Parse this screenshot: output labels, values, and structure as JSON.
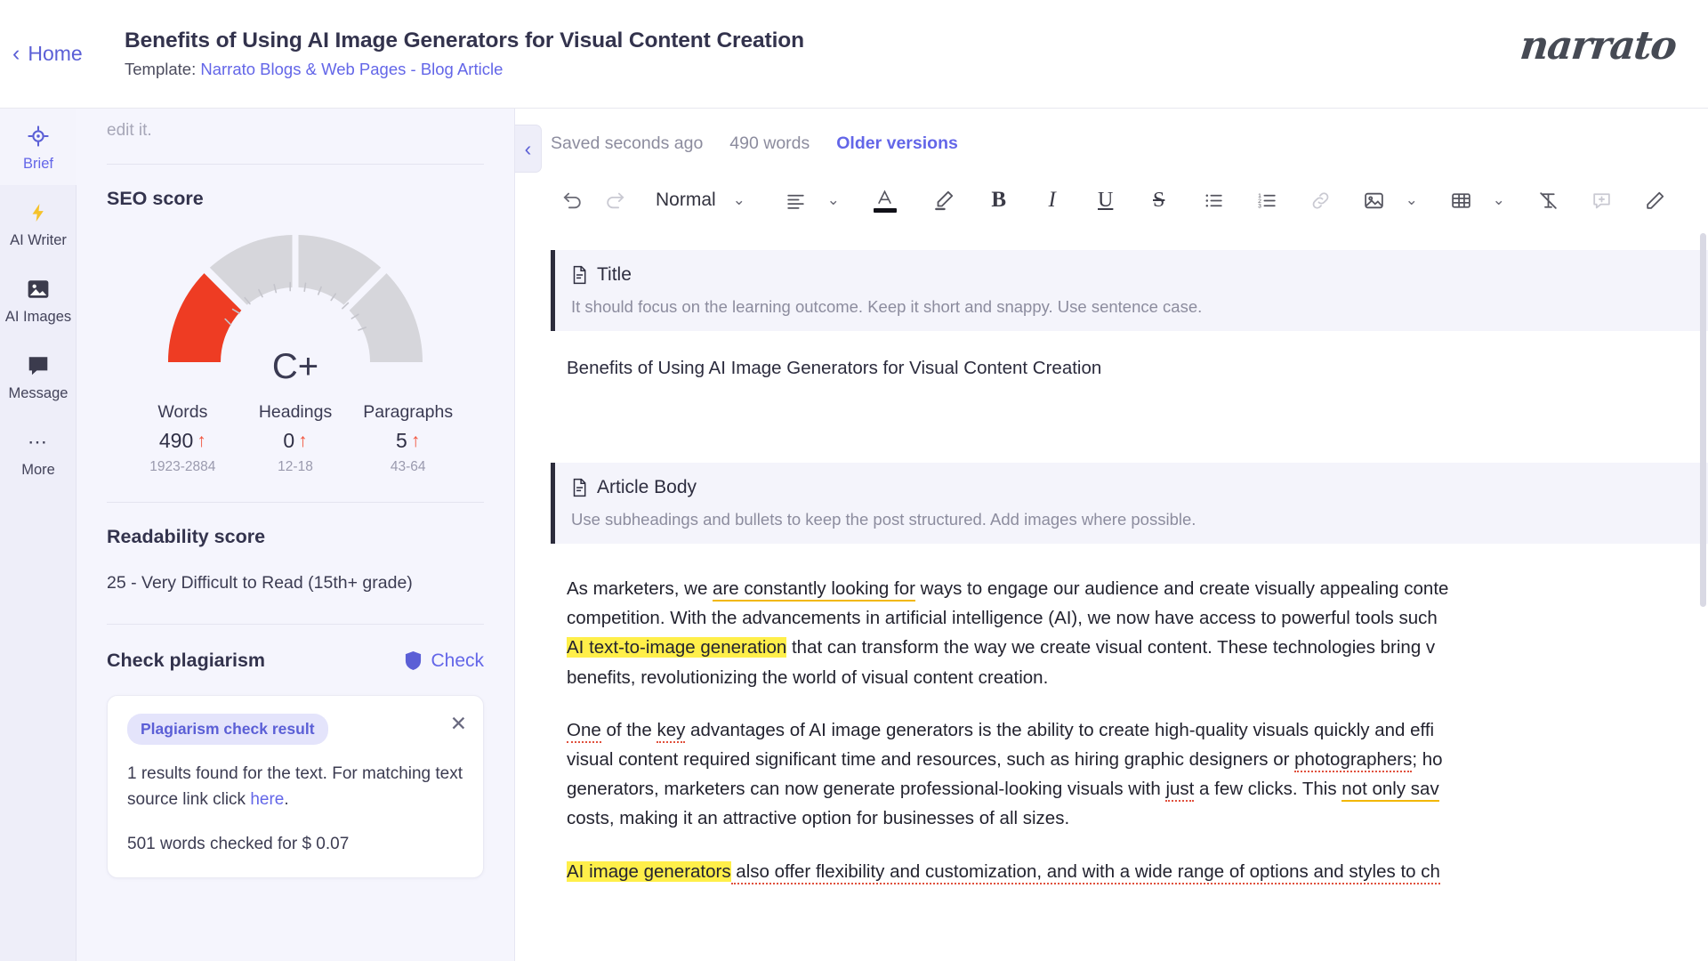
{
  "topbar": {
    "home_label": "Home",
    "doc_title": "Benefits of Using AI Image Generators for Visual Content Creation",
    "template_prefix": "Template: ",
    "template_name": "Narrato Blogs & Web Pages - Blog Article",
    "brand": "narrato"
  },
  "rail": {
    "items": [
      {
        "label": "Brief",
        "icon": "target-icon",
        "active": true
      },
      {
        "label": "AI Writer",
        "icon": "lightning-icon",
        "active": false
      },
      {
        "label": "AI Images",
        "icon": "image-icon",
        "active": false
      },
      {
        "label": "Message",
        "icon": "chat-icon",
        "active": false
      },
      {
        "label": "More",
        "icon": "ellipsis-icon",
        "active": false
      }
    ]
  },
  "panel": {
    "scrolled_text": "edit it.",
    "seo": {
      "title": "SEO score",
      "grade": "C+",
      "stats": [
        {
          "label": "Words",
          "value": "490",
          "trend": "up",
          "range": "1923-2884"
        },
        {
          "label": "Headings",
          "value": "0",
          "trend": "up",
          "range": "12-18"
        },
        {
          "label": "Paragraphs",
          "value": "5",
          "trend": "up",
          "range": "43-64"
        }
      ]
    },
    "readability": {
      "title": "Readability score",
      "value": "25 - Very Difficult to Read (15th+ grade)"
    },
    "plagiarism": {
      "title": "Check plagiarism",
      "check_label": "Check",
      "badge": "Plagiarism check result",
      "result_text_a": "1 results found for the text. For matching text source link click ",
      "result_link": "here",
      "result_text_b": ".",
      "cost_text": "501 words checked for $ 0.07"
    }
  },
  "editor": {
    "saved_text": "Saved seconds ago",
    "word_count": "490 words",
    "older_versions": "Older versions",
    "toolbar": {
      "undo": "undo-icon",
      "redo": "redo-icon",
      "style_value": "Normal",
      "align": "align-left-icon",
      "text_color": "text-color-icon",
      "highlight": "highlighter-icon",
      "bold": "B",
      "italic": "I",
      "underline": "U",
      "strike": "S",
      "bullet_list": "bullet-list-icon",
      "numbered_list": "numbered-list-icon",
      "link": "link-icon",
      "image": "image-icon",
      "table": "table-icon",
      "clear_format": "clear-format-icon",
      "comment": "comment-icon",
      "pencil": "pencil-icon"
    },
    "title_block": {
      "label": "Title",
      "hint": "It should focus on the learning outcome. Keep it short and snappy. Use sentence case.",
      "value": "Benefits of Using AI Image Generators for Visual Content Creation"
    },
    "body_block": {
      "label": "Article Body",
      "hint": "Use subheadings and bullets to keep the post structured. Add images where possible."
    },
    "paragraphs": [
      {
        "lines": [
          [
            {
              "t": "As marketers, we ",
              "s": ""
            },
            {
              "t": "are constantly looking for",
              "s": "uline"
            },
            {
              "t": " ways to engage our audience and create visually appealing conte",
              "s": ""
            }
          ],
          [
            {
              "t": "competition. With the advancements in artificial intelligence (AI), we now have access to powerful tools such",
              "s": ""
            }
          ],
          [
            {
              "t": "AI text-to-image generation",
              "s": "hl"
            },
            {
              "t": " that can transform the way we create visual content. These technologies bring v",
              "s": ""
            }
          ],
          [
            {
              "t": "benefits, revolutionizing the world of visual content creation.",
              "s": ""
            }
          ]
        ]
      },
      {
        "lines": [
          [
            {
              "t": "One",
              "s": "rline"
            },
            {
              "t": " of the ",
              "s": ""
            },
            {
              "t": "key",
              "s": "rline"
            },
            {
              "t": " advantages of AI image generators is the ability to create high-quality visuals quickly and effi",
              "s": ""
            }
          ],
          [
            {
              "t": "visual content required significant time and resources, such as hiring graphic designers or ",
              "s": ""
            },
            {
              "t": "photographers",
              "s": "rline"
            },
            {
              "t": "; ho",
              "s": ""
            }
          ],
          [
            {
              "t": "generators, marketers can now generate professional-looking visuals with ",
              "s": ""
            },
            {
              "t": "just",
              "s": "rline"
            },
            {
              "t": " a few clicks. This ",
              "s": ""
            },
            {
              "t": "not only sav",
              "s": "uline"
            }
          ],
          [
            {
              "t": "costs, making it an attractive option for businesses of all sizes.",
              "s": ""
            }
          ]
        ]
      },
      {
        "lines": [
          [
            {
              "t": "AI image generators",
              "s": "hl"
            },
            {
              "t": " also offer flexibility and customization, and with a wide range of options and styles to ch",
              "s": "rline"
            }
          ]
        ]
      }
    ]
  },
  "colors": {
    "accent": "#6366e8",
    "gauge_red": "#ee3c23",
    "gauge_grey": "#d6d6db",
    "highlight": "#ffef4a",
    "trend_up": "#f2543d"
  }
}
